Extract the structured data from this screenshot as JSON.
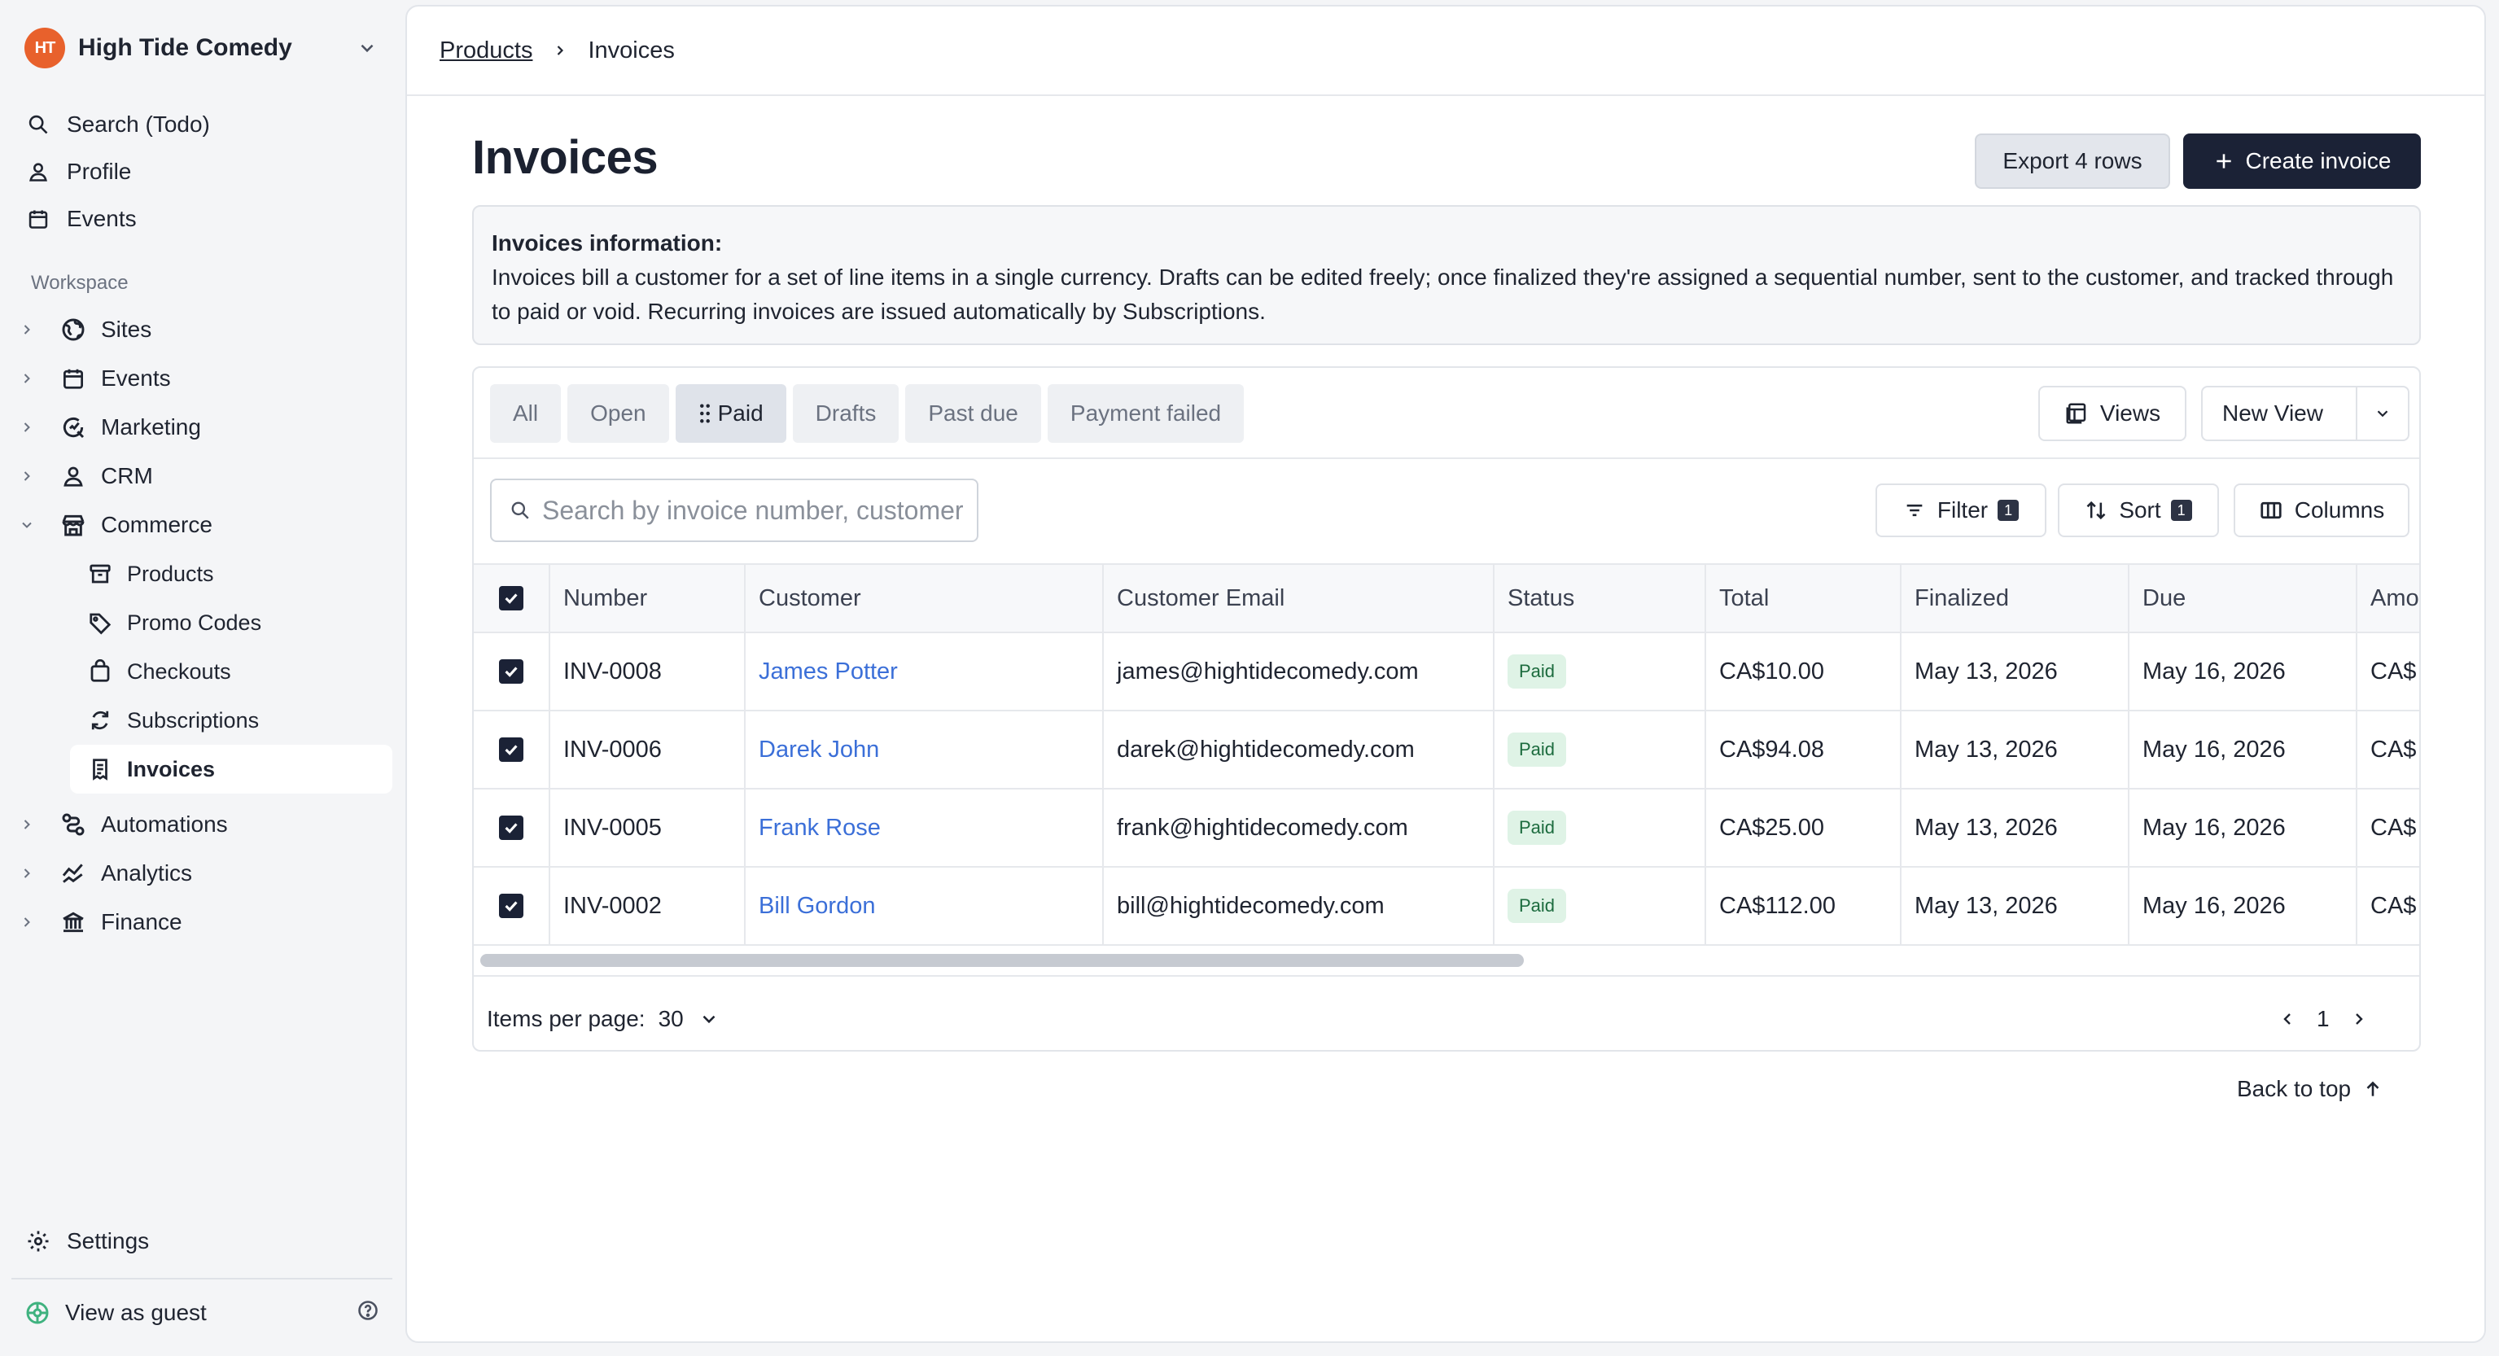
{
  "org": {
    "logo_text": "HT",
    "name": "High Tide Comedy"
  },
  "nav_top": [
    {
      "label": "Search (Todo)",
      "icon": "search-icon"
    },
    {
      "label": "Profile",
      "icon": "user-icon"
    },
    {
      "label": "Events",
      "icon": "calendar-icon"
    }
  ],
  "workspace": {
    "section_label": "Workspace",
    "items": [
      {
        "label": "Sites",
        "icon": "globe-icon",
        "expanded": false
      },
      {
        "label": "Events",
        "icon": "calendar-icon",
        "expanded": false
      },
      {
        "label": "Marketing",
        "icon": "magnifier-chart-icon",
        "expanded": false
      },
      {
        "label": "CRM",
        "icon": "user-icon",
        "expanded": false
      },
      {
        "label": "Commerce",
        "icon": "store-icon",
        "expanded": true
      },
      {
        "label": "Automations",
        "icon": "automation-icon",
        "expanded": false
      },
      {
        "label": "Analytics",
        "icon": "analytics-icon",
        "expanded": false
      },
      {
        "label": "Finance",
        "icon": "bank-icon",
        "expanded": false
      }
    ],
    "commerce_children": [
      {
        "label": "Products",
        "icon": "archive-icon",
        "active": false
      },
      {
        "label": "Promo Codes",
        "icon": "tag-icon",
        "active": false
      },
      {
        "label": "Checkouts",
        "icon": "bag-icon",
        "active": false
      },
      {
        "label": "Subscriptions",
        "icon": "refresh-icon",
        "active": false
      },
      {
        "label": "Invoices",
        "icon": "receipt-icon",
        "active": true
      }
    ]
  },
  "sidebar_footer": {
    "settings": "Settings",
    "guest": "View as guest"
  },
  "breadcrumb": {
    "parent": "Products",
    "current": "Invoices"
  },
  "page": {
    "title": "Invoices",
    "export_label": "Export 4 rows",
    "create_label": "Create invoice"
  },
  "info": {
    "title": "Invoices information:",
    "body": "Invoices bill a customer for a set of line items in a single currency. Drafts can be edited freely; once finalized they're assigned a sequential number, sent to the customer, and tracked through to paid or void. Recurring invoices are issued automatically by Subscriptions."
  },
  "tabs": [
    {
      "label": "All",
      "active": false
    },
    {
      "label": "Open",
      "active": false
    },
    {
      "label": "Paid",
      "active": true
    },
    {
      "label": "Drafts",
      "active": false
    },
    {
      "label": "Past due",
      "active": false
    },
    {
      "label": "Payment failed",
      "active": false
    }
  ],
  "toolbar": {
    "views": "Views",
    "new_view": "New View",
    "search_placeholder": "Search by invoice number, customer",
    "filter": "Filter",
    "filter_count": "1",
    "sort": "Sort",
    "sort_count": "1",
    "columns": "Columns"
  },
  "table": {
    "columns": [
      "Number",
      "Customer",
      "Customer Email",
      "Status",
      "Total",
      "Finalized",
      "Due",
      "Amo"
    ],
    "rows": [
      {
        "number": "INV-0008",
        "customer": "James Potter",
        "email": "james@hightidecomedy.com",
        "status": "Paid",
        "total": "CA$10.00",
        "finalized": "May 13, 2026",
        "due": "May 16, 2026",
        "amount": "CA$"
      },
      {
        "number": "INV-0006",
        "customer": "Darek John",
        "email": "darek@hightidecomedy.com",
        "status": "Paid",
        "total": "CA$94.08",
        "finalized": "May 13, 2026",
        "due": "May 16, 2026",
        "amount": "CA$"
      },
      {
        "number": "INV-0005",
        "customer": "Frank Rose",
        "email": "frank@hightidecomedy.com",
        "status": "Paid",
        "total": "CA$25.00",
        "finalized": "May 13, 2026",
        "due": "May 16, 2026",
        "amount": "CA$"
      },
      {
        "number": "INV-0002",
        "customer": "Bill Gordon",
        "email": "bill@hightidecomedy.com",
        "status": "Paid",
        "total": "CA$112.00",
        "finalized": "May 13, 2026",
        "due": "May 16, 2026",
        "amount": "CA$"
      }
    ]
  },
  "pagination": {
    "items_label": "Items per page:",
    "items_value": "30",
    "page": "1"
  },
  "back_to_top": "Back to top",
  "colors": {
    "accent": "#1b2236",
    "brand": "#e8612c",
    "link": "#3b6fd8",
    "paid_bg": "#dff3e6",
    "paid_text": "#1c6b3e"
  }
}
